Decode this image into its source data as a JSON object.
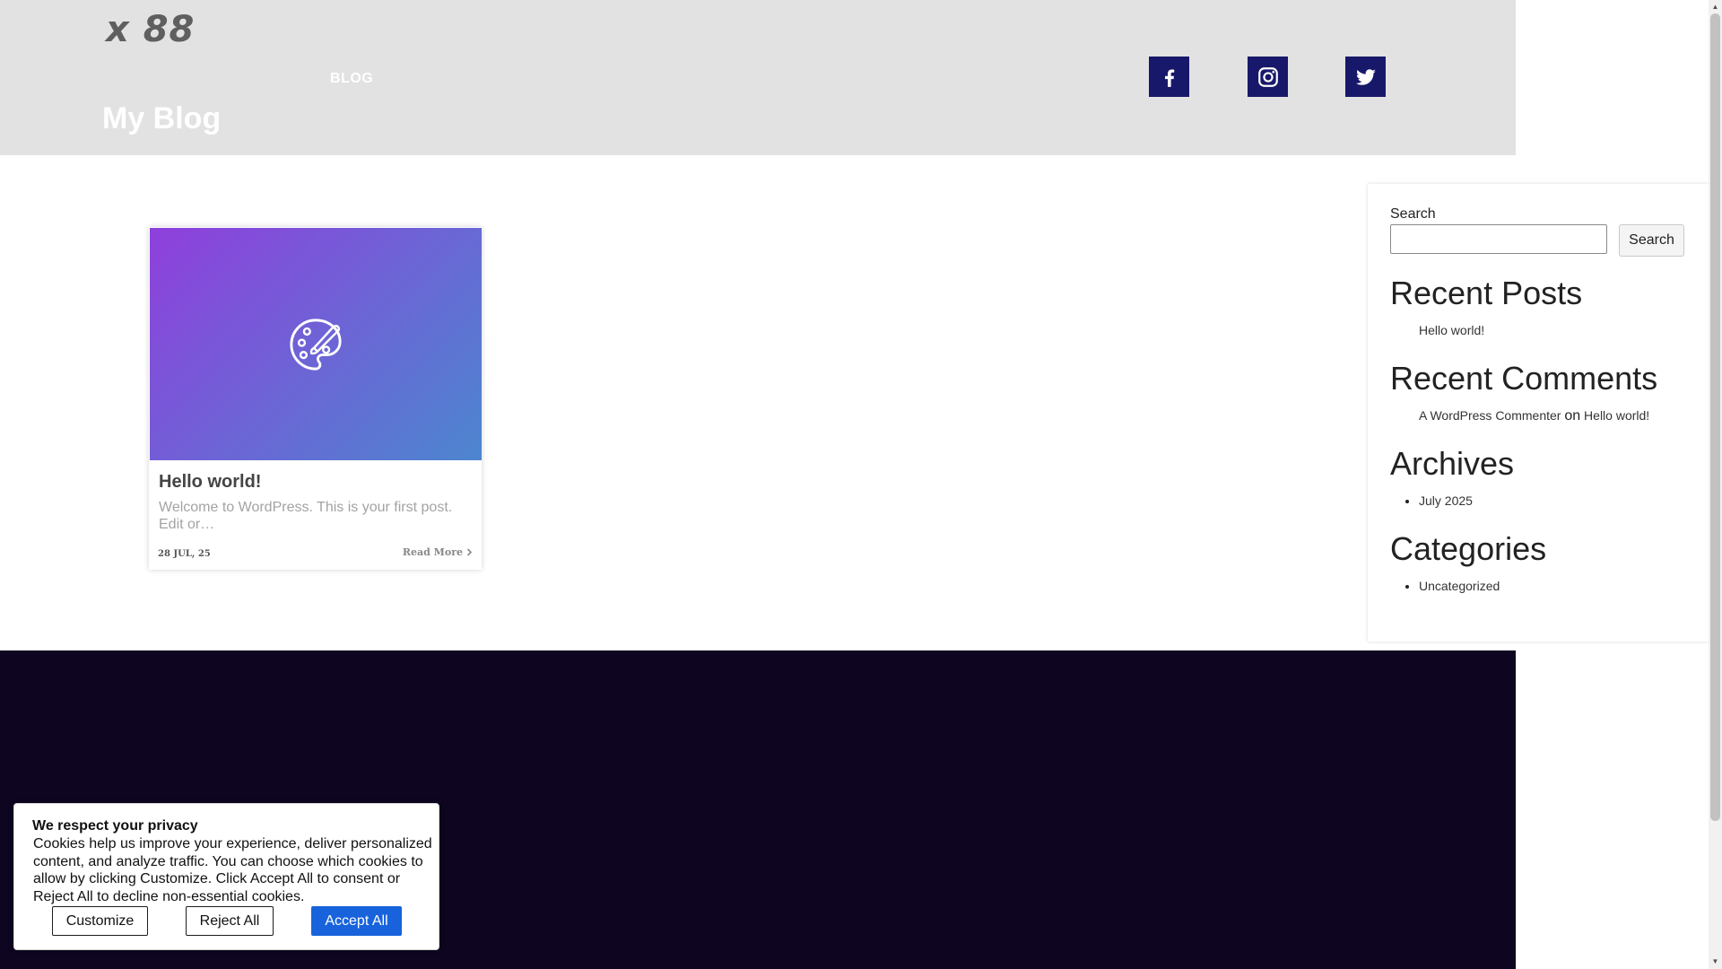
{
  "header": {
    "logo_text": "x 88",
    "nav": [
      {
        "label": "BLOG"
      }
    ],
    "site_title": "My Blog",
    "social": [
      {
        "name": "facebook-icon"
      },
      {
        "name": "instagram-icon"
      },
      {
        "name": "twitter-icon"
      }
    ]
  },
  "posts": [
    {
      "title": "Hello world!",
      "excerpt": "Welcome to WordPress. This is your first post. Edit or…",
      "date": "28 JUL, 25",
      "read_more": "Read More",
      "thumbnail_icon": "palette-icon"
    }
  ],
  "sidebar": {
    "search": {
      "label": "Search",
      "button": "Search",
      "value": ""
    },
    "recent_posts": {
      "heading": "Recent Posts",
      "items": [
        "Hello world!"
      ]
    },
    "recent_comments": {
      "heading": "Recent Comments",
      "items": [
        {
          "author": "A WordPress Commenter",
          "on": "on",
          "post": "Hello world!"
        }
      ]
    },
    "archives": {
      "heading": "Archives",
      "items": [
        "July 2025"
      ]
    },
    "categories": {
      "heading": "Categories",
      "items": [
        "Uncategorized"
      ]
    }
  },
  "cookie_banner": {
    "title": "We respect your privacy",
    "text": "Cookies help us improve your experience, deliver personalized content, and analyze traffic. You can choose which cookies to allow by clicking Customize. Click Accept All to consent or Reject All to decline non-essential cookies.",
    "buttons": {
      "customize": "Customize",
      "reject": "Reject All",
      "accept": "Accept All"
    }
  },
  "colors": {
    "header_bg": "#e2e2e2",
    "social_bg": "#18186a",
    "footer_bg": "#0e0620",
    "accept_button": "#1863dc",
    "card_gradient_start": "#8f3fdc",
    "card_gradient_end": "#4c86cf"
  }
}
